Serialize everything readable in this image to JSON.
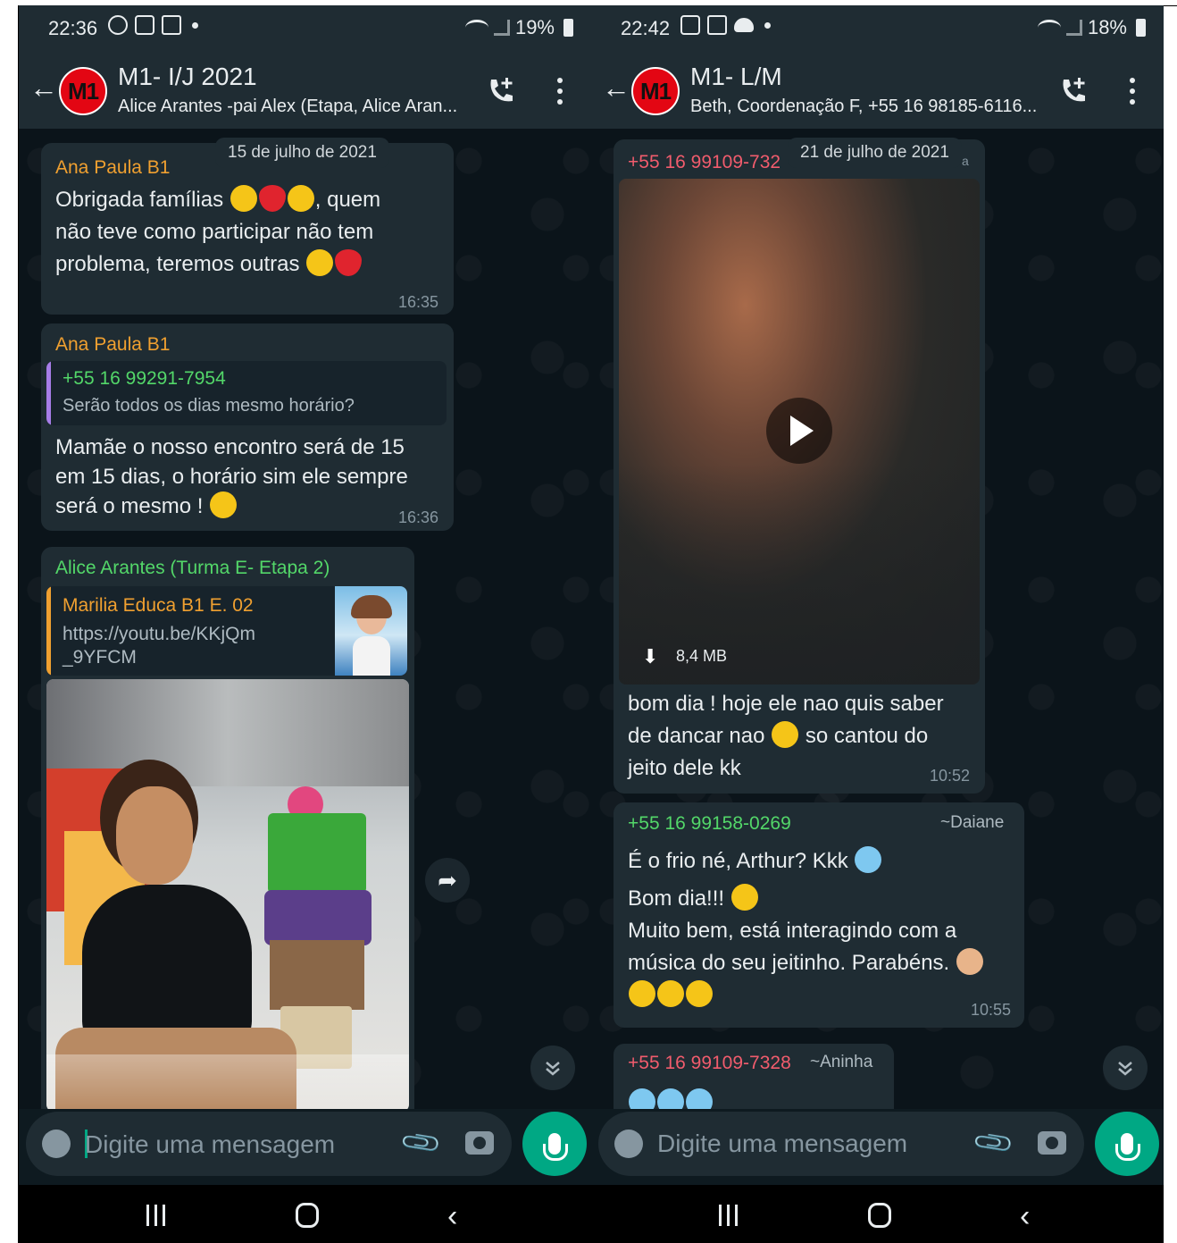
{
  "left": {
    "status": {
      "time": "22:36",
      "battery": "19%"
    },
    "header": {
      "avatar": "M1",
      "title": "M1- I/J 2021",
      "subtitle": "Alice Arantes -pai Alex (Etapa, Alice Aran..."
    },
    "date_chip": "15 de julho de 2021",
    "messages": [
      {
        "sender": "Ana Paula B1",
        "lines": [
          "Obrigada famílias",
          ", quem",
          "não teve como participar  não tem",
          "problema, teremos  outras"
        ],
        "time": "16:35"
      },
      {
        "sender": "Ana Paula B1",
        "quote_author": "+55 16 99291-7954",
        "quote_text": "Serão todos os dias mesmo horário?",
        "lines": [
          "Mamãe  o nosso encontro será de 15",
          "em 15 dias, o horário sim ele sempre",
          "será o mesmo !"
        ],
        "time": "16:36"
      },
      {
        "sender": "Alice Arantes (Turma E- Etapa 2)",
        "quote_author": "Marilia Educa B1 E. 02",
        "quote_text_1": "https://youtu.be/KKjQm",
        "quote_text_2": "_9YFCM"
      }
    ],
    "composer": {
      "placeholder": "Digite uma mensagem"
    }
  },
  "right": {
    "status": {
      "time": "22:42",
      "battery": "18%"
    },
    "header": {
      "avatar": "M1",
      "title": "M1- L/M",
      "subtitle": "Beth, Coordenação F, +55 16 98185-6116..."
    },
    "date_chip": "21 de julho de 2021",
    "messages": [
      {
        "sender": "+55 16 99109-732",
        "sender_suffix": "a",
        "file_size": "8,4 MB",
        "lines": [
          "bom dia ! hoje ele nao quis saber",
          "de dancar nao",
          "so cantou do",
          "jeito dele kk"
        ],
        "time": "10:52"
      },
      {
        "sender": "+55 16 99158-0269",
        "alias": "~Daiane",
        "lines": [
          "É o frio né, Arthur? Kkk",
          "Bom dia!!!",
          "Muito bem, está interagindo com a",
          "música do seu jeitinho. Parabéns."
        ],
        "time": "10:55"
      },
      {
        "sender": "+55 16 99109-7328",
        "alias": "~Aninha"
      }
    ],
    "composer": {
      "placeholder": "Digite uma mensagem"
    }
  },
  "colors": {
    "accent_green": "#00a884",
    "sender_orange": "#f0a030",
    "sender_green": "#53d769",
    "sender_red": "#f15c6d",
    "bubble": "#1f2c33"
  },
  "icons": [
    "back-arrow-icon",
    "add-call-icon",
    "more-options-icon",
    "emoji-icon",
    "attach-icon",
    "camera-icon",
    "mic-icon",
    "play-icon",
    "download-icon",
    "forward-icon",
    "scroll-down-icon"
  ]
}
